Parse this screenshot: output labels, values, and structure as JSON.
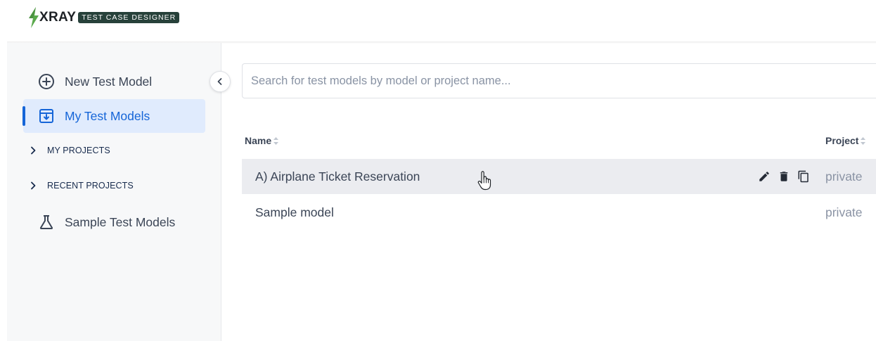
{
  "brand": {
    "name": "XRAY",
    "badge": "TEST CASE DESIGNER",
    "bolt_color": "#5aa94c"
  },
  "sidebar": {
    "items": [
      {
        "label": "New Test Model",
        "icon": "plus-circle-icon"
      },
      {
        "label": "My Test Models",
        "icon": "archive-box-icon",
        "active": true
      },
      {
        "label": "Sample Test Models",
        "icon": "flask-icon"
      }
    ],
    "sections": [
      {
        "label": "MY PROJECTS",
        "icon": "chevron-right-icon"
      },
      {
        "label": "RECENT PROJECTS",
        "icon": "chevron-right-icon"
      }
    ],
    "collapse_icon": "chevron-left-icon"
  },
  "search": {
    "placeholder": "Search for test models by model or project name..."
  },
  "table": {
    "columns": [
      "Name",
      "Project"
    ],
    "rows": [
      {
        "name": "A) Airplane Ticket Reservation",
        "project": "private",
        "hover": true
      },
      {
        "name": "Sample model",
        "project": "private"
      }
    ],
    "row_actions": [
      "edit-icon",
      "delete-icon",
      "copy-icon"
    ]
  },
  "colors": {
    "accent": "#1565d8",
    "active_bg": "#e0ebfd",
    "row_hover": "#ebecf0"
  }
}
